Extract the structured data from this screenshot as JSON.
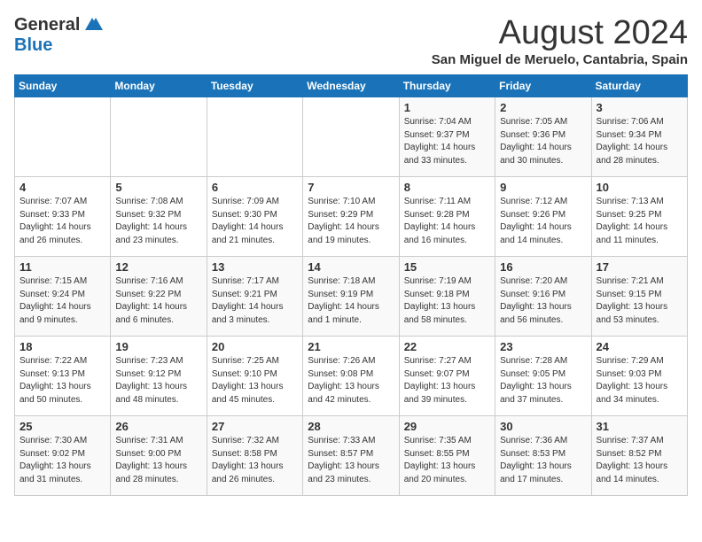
{
  "logo": {
    "general": "General",
    "blue": "Blue"
  },
  "title": {
    "month": "August 2024",
    "location": "San Miguel de Meruelo, Cantabria, Spain"
  },
  "headers": [
    "Sunday",
    "Monday",
    "Tuesday",
    "Wednesday",
    "Thursday",
    "Friday",
    "Saturday"
  ],
  "weeks": [
    [
      {
        "day": "",
        "info": ""
      },
      {
        "day": "",
        "info": ""
      },
      {
        "day": "",
        "info": ""
      },
      {
        "day": "",
        "info": ""
      },
      {
        "day": "1",
        "info": "Sunrise: 7:04 AM\nSunset: 9:37 PM\nDaylight: 14 hours\nand 33 minutes."
      },
      {
        "day": "2",
        "info": "Sunrise: 7:05 AM\nSunset: 9:36 PM\nDaylight: 14 hours\nand 30 minutes."
      },
      {
        "day": "3",
        "info": "Sunrise: 7:06 AM\nSunset: 9:34 PM\nDaylight: 14 hours\nand 28 minutes."
      }
    ],
    [
      {
        "day": "4",
        "info": "Sunrise: 7:07 AM\nSunset: 9:33 PM\nDaylight: 14 hours\nand 26 minutes."
      },
      {
        "day": "5",
        "info": "Sunrise: 7:08 AM\nSunset: 9:32 PM\nDaylight: 14 hours\nand 23 minutes."
      },
      {
        "day": "6",
        "info": "Sunrise: 7:09 AM\nSunset: 9:30 PM\nDaylight: 14 hours\nand 21 minutes."
      },
      {
        "day": "7",
        "info": "Sunrise: 7:10 AM\nSunset: 9:29 PM\nDaylight: 14 hours\nand 19 minutes."
      },
      {
        "day": "8",
        "info": "Sunrise: 7:11 AM\nSunset: 9:28 PM\nDaylight: 14 hours\nand 16 minutes."
      },
      {
        "day": "9",
        "info": "Sunrise: 7:12 AM\nSunset: 9:26 PM\nDaylight: 14 hours\nand 14 minutes."
      },
      {
        "day": "10",
        "info": "Sunrise: 7:13 AM\nSunset: 9:25 PM\nDaylight: 14 hours\nand 11 minutes."
      }
    ],
    [
      {
        "day": "11",
        "info": "Sunrise: 7:15 AM\nSunset: 9:24 PM\nDaylight: 14 hours\nand 9 minutes."
      },
      {
        "day": "12",
        "info": "Sunrise: 7:16 AM\nSunset: 9:22 PM\nDaylight: 14 hours\nand 6 minutes."
      },
      {
        "day": "13",
        "info": "Sunrise: 7:17 AM\nSunset: 9:21 PM\nDaylight: 14 hours\nand 3 minutes."
      },
      {
        "day": "14",
        "info": "Sunrise: 7:18 AM\nSunset: 9:19 PM\nDaylight: 14 hours\nand 1 minute."
      },
      {
        "day": "15",
        "info": "Sunrise: 7:19 AM\nSunset: 9:18 PM\nDaylight: 13 hours\nand 58 minutes."
      },
      {
        "day": "16",
        "info": "Sunrise: 7:20 AM\nSunset: 9:16 PM\nDaylight: 13 hours\nand 56 minutes."
      },
      {
        "day": "17",
        "info": "Sunrise: 7:21 AM\nSunset: 9:15 PM\nDaylight: 13 hours\nand 53 minutes."
      }
    ],
    [
      {
        "day": "18",
        "info": "Sunrise: 7:22 AM\nSunset: 9:13 PM\nDaylight: 13 hours\nand 50 minutes."
      },
      {
        "day": "19",
        "info": "Sunrise: 7:23 AM\nSunset: 9:12 PM\nDaylight: 13 hours\nand 48 minutes."
      },
      {
        "day": "20",
        "info": "Sunrise: 7:25 AM\nSunset: 9:10 PM\nDaylight: 13 hours\nand 45 minutes."
      },
      {
        "day": "21",
        "info": "Sunrise: 7:26 AM\nSunset: 9:08 PM\nDaylight: 13 hours\nand 42 minutes."
      },
      {
        "day": "22",
        "info": "Sunrise: 7:27 AM\nSunset: 9:07 PM\nDaylight: 13 hours\nand 39 minutes."
      },
      {
        "day": "23",
        "info": "Sunrise: 7:28 AM\nSunset: 9:05 PM\nDaylight: 13 hours\nand 37 minutes."
      },
      {
        "day": "24",
        "info": "Sunrise: 7:29 AM\nSunset: 9:03 PM\nDaylight: 13 hours\nand 34 minutes."
      }
    ],
    [
      {
        "day": "25",
        "info": "Sunrise: 7:30 AM\nSunset: 9:02 PM\nDaylight: 13 hours\nand 31 minutes."
      },
      {
        "day": "26",
        "info": "Sunrise: 7:31 AM\nSunset: 9:00 PM\nDaylight: 13 hours\nand 28 minutes."
      },
      {
        "day": "27",
        "info": "Sunrise: 7:32 AM\nSunset: 8:58 PM\nDaylight: 13 hours\nand 26 minutes."
      },
      {
        "day": "28",
        "info": "Sunrise: 7:33 AM\nSunset: 8:57 PM\nDaylight: 13 hours\nand 23 minutes."
      },
      {
        "day": "29",
        "info": "Sunrise: 7:35 AM\nSunset: 8:55 PM\nDaylight: 13 hours\nand 20 minutes."
      },
      {
        "day": "30",
        "info": "Sunrise: 7:36 AM\nSunset: 8:53 PM\nDaylight: 13 hours\nand 17 minutes."
      },
      {
        "day": "31",
        "info": "Sunrise: 7:37 AM\nSunset: 8:52 PM\nDaylight: 13 hours\nand 14 minutes."
      }
    ]
  ]
}
